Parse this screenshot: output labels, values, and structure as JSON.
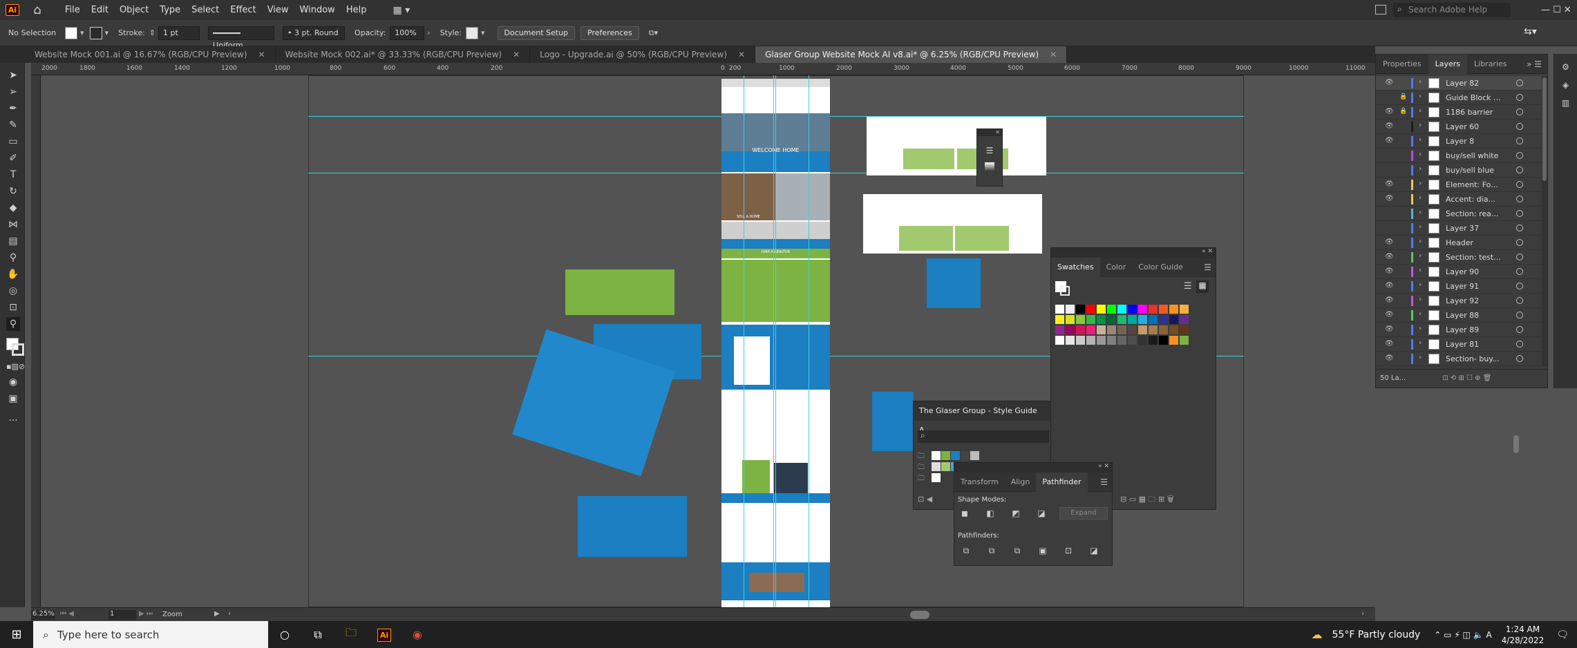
{
  "app": {
    "logo": "Ai",
    "menu": [
      "File",
      "Edit",
      "Object",
      "Type",
      "Select",
      "Effect",
      "View",
      "Window",
      "Help"
    ],
    "search_placeholder": "Search Adobe Help"
  },
  "control": {
    "selection": "No Selection",
    "stroke_label": "Stroke:",
    "stroke_value": "1 pt",
    "profile": "Uniform",
    "brush": "3 pt. Round",
    "opacity_label": "Opacity:",
    "opacity_value": "100%",
    "style_label": "Style:",
    "document_setup": "Document Setup",
    "preferences": "Preferences"
  },
  "tabs": [
    {
      "label": "Website Mock 001.ai @ 16.67% (RGB/CPU Preview)",
      "active": false
    },
    {
      "label": "Website Mock 002.ai* @ 33.33% (RGB/CPU Preview)",
      "active": false
    },
    {
      "label": "Logo - Upgrade.ai @ 50% (RGB/CPU Preview)",
      "active": false
    },
    {
      "label": "Glaser Group Website Mock AI v8.ai* @ 6.25% (RGB/CPU Preview)",
      "active": true
    }
  ],
  "ruler": {
    "ticks": [
      "2000",
      "1800",
      "1600",
      "1400",
      "1200",
      "1000",
      "800",
      "600",
      "400",
      "200",
      "0",
      "200",
      "1000",
      "2000",
      "3000",
      "4000",
      "5000",
      "6000",
      "7000",
      "8000",
      "9000",
      "10000",
      "11000"
    ]
  },
  "status": {
    "zoom": "6.25%",
    "artboard": "1",
    "tool": "Zoom"
  },
  "artboard_text": {
    "welcome": "WELCOME HOME",
    "sell_home": "SELL A HOME",
    "hire_realtor": "HIRE A REALTOR"
  },
  "right_panel": {
    "tabs": [
      "Properties",
      "Layers",
      "Libraries"
    ],
    "layers": [
      {
        "name": "Layer 82",
        "color": "#4f7df2",
        "visible": true,
        "locked": false
      },
      {
        "name": "Guide Block ...",
        "color": "#4f7df2",
        "visible": false,
        "locked": true
      },
      {
        "name": "1186 barrier",
        "color": "#4f7df2",
        "visible": true,
        "locked": true
      },
      {
        "name": "Layer 60",
        "color": "#1b1b1b",
        "visible": true,
        "locked": false
      },
      {
        "name": "Layer 8",
        "color": "#4f7df2",
        "visible": true,
        "locked": false
      },
      {
        "name": "buy/sell white",
        "color": "#b34fe0",
        "visible": false,
        "locked": false
      },
      {
        "name": "buy/sell blue",
        "color": "#4f7df2",
        "visible": false,
        "locked": false
      },
      {
        "name": "Element: Fo...",
        "color": "#e0d14f",
        "visible": true,
        "locked": false
      },
      {
        "name": "Accent: dia...",
        "color": "#e0d14f",
        "visible": true,
        "locked": false
      },
      {
        "name": "Section: rea...",
        "color": "#4fb8e0",
        "visible": false,
        "locked": false
      },
      {
        "name": "Layer 37",
        "color": "#4f7df2",
        "visible": false,
        "locked": false
      },
      {
        "name": "Header",
        "color": "#4f7df2",
        "visible": true,
        "locked": false
      },
      {
        "name": "Section: test...",
        "color": "#4fd05f",
        "visible": true,
        "locked": false
      },
      {
        "name": "Layer 90",
        "color": "#d04fe0",
        "visible": true,
        "locked": false
      },
      {
        "name": "Layer 91",
        "color": "#4f7df2",
        "visible": true,
        "locked": false
      },
      {
        "name": "Layer 92",
        "color": "#d04fe0",
        "visible": true,
        "locked": false
      },
      {
        "name": "Layer 88",
        "color": "#4fd05f",
        "visible": true,
        "locked": false
      },
      {
        "name": "Layer 89",
        "color": "#4f7df2",
        "visible": true,
        "locked": false
      },
      {
        "name": "Layer 81",
        "color": "#4f7df2",
        "visible": true,
        "locked": false
      },
      {
        "name": "Section- buy...",
        "color": "#4f7df2",
        "visible": true,
        "locked": false
      }
    ],
    "layer_count": "50 La..."
  },
  "swatches_panel": {
    "tabs": [
      "Swatches",
      "Color",
      "Color Guide"
    ]
  },
  "style_guide_panel": {
    "title": "The Glaser Group - Style Guide A..."
  },
  "pathfinder_panel": {
    "tabs": [
      "Transform",
      "Align",
      "Pathfinder"
    ],
    "shape_modes": "Shape Modes:",
    "expand": "Expand",
    "pathfinders": "Pathfinders:"
  },
  "taskbar": {
    "search_placeholder": "Type here to search",
    "weather": "55°F  Partly cloudy",
    "time": "1:24 AM",
    "date": "4/28/2022"
  }
}
